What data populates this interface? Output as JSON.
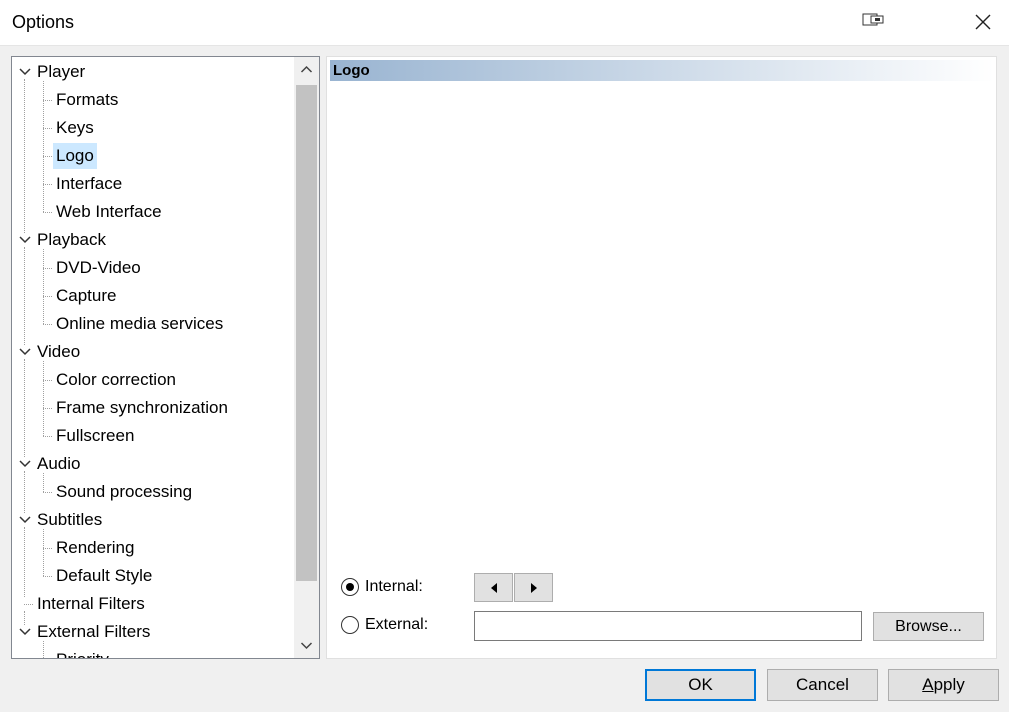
{
  "window": {
    "title": "Options"
  },
  "tree": {
    "items": [
      {
        "label": "Player",
        "level": 0,
        "expanded": true
      },
      {
        "label": "Formats",
        "level": 1
      },
      {
        "label": "Keys",
        "level": 1
      },
      {
        "label": "Logo",
        "level": 1,
        "selected": true
      },
      {
        "label": "Interface",
        "level": 1
      },
      {
        "label": "Web Interface",
        "level": 1
      },
      {
        "label": "Playback",
        "level": 0,
        "expanded": true
      },
      {
        "label": "DVD-Video",
        "level": 1
      },
      {
        "label": "Capture",
        "level": 1
      },
      {
        "label": "Online media services",
        "level": 1
      },
      {
        "label": "Video",
        "level": 0,
        "expanded": true
      },
      {
        "label": "Color correction",
        "level": 1
      },
      {
        "label": "Frame synchronization",
        "level": 1
      },
      {
        "label": "Fullscreen",
        "level": 1
      },
      {
        "label": "Audio",
        "level": 0,
        "expanded": true
      },
      {
        "label": "Sound processing",
        "level": 1
      },
      {
        "label": "Subtitles",
        "level": 0,
        "expanded": true
      },
      {
        "label": "Rendering",
        "level": 1
      },
      {
        "label": "Default Style",
        "level": 1
      },
      {
        "label": "Internal Filters",
        "level": 0,
        "expanded": false
      },
      {
        "label": "External Filters",
        "level": 0,
        "expanded": true
      },
      {
        "label": "Priority",
        "level": 1
      }
    ]
  },
  "panel": {
    "header": "Logo",
    "internal_label": "Internal:",
    "internal_checked": true,
    "external_label": "External:",
    "external_checked": false,
    "external_value": "",
    "browse_label": "Browse..."
  },
  "buttons": {
    "ok": "OK",
    "cancel": "Cancel",
    "apply": "Apply"
  },
  "colors": {
    "selection": "#cce8ff",
    "header_gradient_start": "#99b4d1",
    "default_button_border": "#0078d7"
  }
}
